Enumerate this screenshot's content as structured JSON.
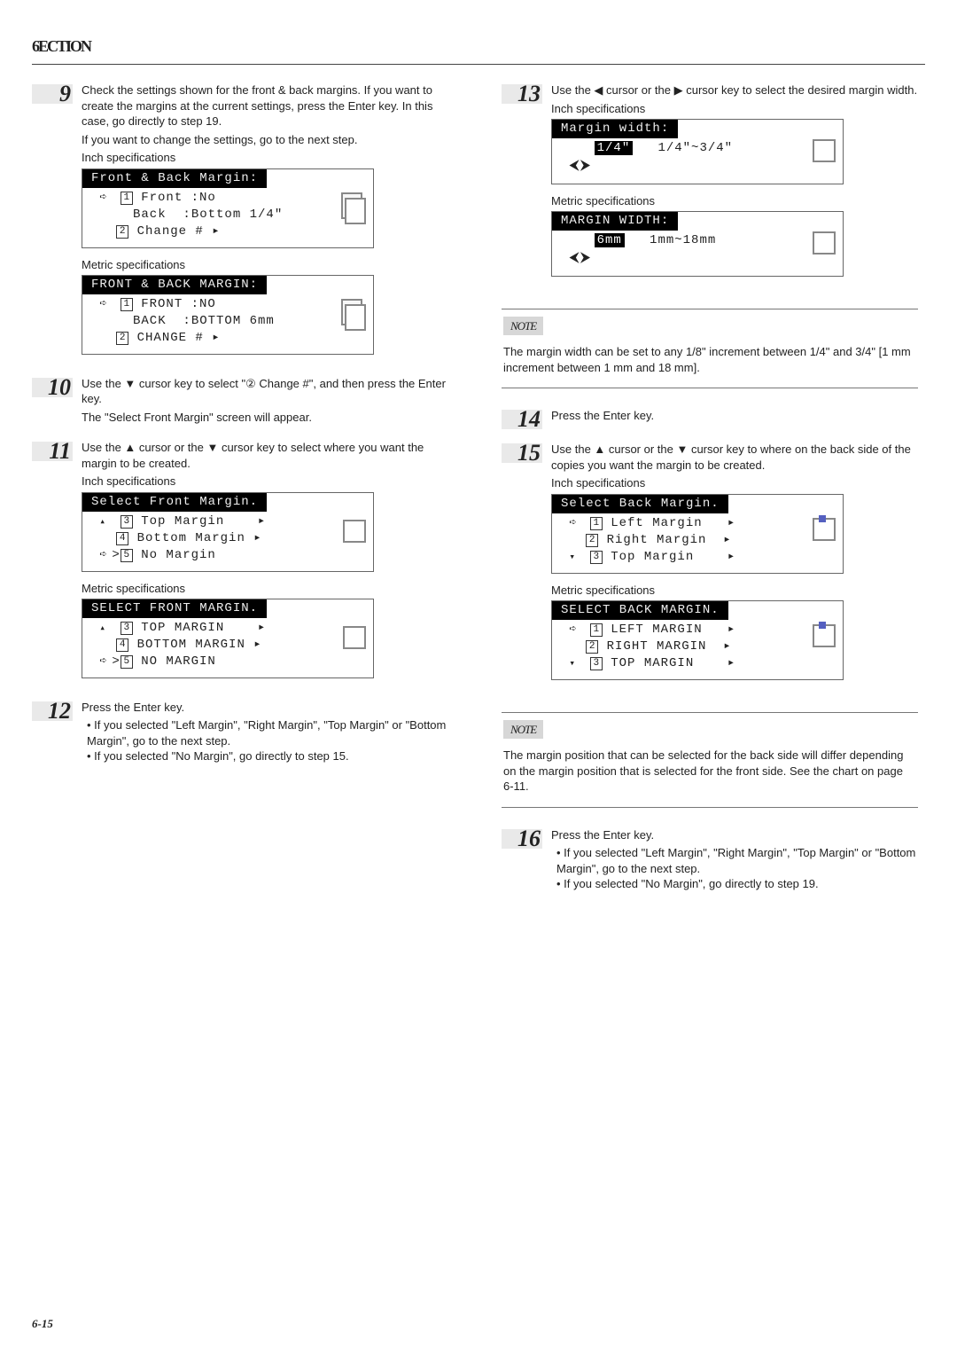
{
  "header": "6ECTION ",
  "page_footer": "6-15",
  "left": {
    "step9": {
      "num": "9",
      "p1": "Check the settings shown for the front & back margins. If you want to create the margins at the current settings, press the Enter key. In this case, go directly to step 19.",
      "p2": "If you want to change the settings, go to the next step.",
      "inch_label": "Inch specifications",
      "lcd_inch": {
        "title": "Front & Back Margin:",
        "r1a": "Front :No",
        "r2": "     Back  :Bottom 1/4\"",
        "r3a": "Change # ▸"
      },
      "metric_label": "Metric specifications",
      "lcd_metric": {
        "title": "FRONT & BACK MARGIN:",
        "r1a": "FRONT :NO",
        "r2": "     BACK  :BOTTOM 6mm",
        "r3a": "CHANGE # ▸"
      }
    },
    "step10": {
      "num": "10",
      "p1": "Use the ▼ cursor key to select \"② Change #\", and then press the Enter key.",
      "p2": "The \"Select Front Margin\" screen will appear."
    },
    "step11": {
      "num": "11",
      "p1": "Use the ▲ cursor or the ▼ cursor key to select where you want the margin to be created.",
      "inch_label": "Inch specifications",
      "lcd_inch": {
        "title": "Select Front Margin.",
        "r1": "Top Margin    ▸",
        "r2": "Bottom Margin ▸",
        "r3": "No Margin"
      },
      "metric_label": "Metric specifications",
      "lcd_metric": {
        "title": "SELECT FRONT MARGIN.",
        "r1": "TOP MARGIN    ▸",
        "r2": "BOTTOM MARGIN ▸",
        "r3": "NO MARGIN"
      }
    },
    "step12": {
      "num": "12",
      "p1": "Press the Enter key.",
      "b1": "If you selected \"Left Margin\", \"Right Margin\", \"Top Margin\" or \"Bottom Margin\", go to the next step.",
      "b2": "If you selected \"No Margin\", go directly to step 15."
    }
  },
  "right": {
    "step13": {
      "num": "13",
      "p1": "Use the ◀ cursor or the ▶ cursor key to select the desired margin width.",
      "inch_label": "Inch specifications",
      "lcd_inch": {
        "title": "Margin width:",
        "val": "1/4\"",
        "range": "1/4\"~3/4\""
      },
      "metric_label": "Metric specifications",
      "lcd_metric": {
        "title": "MARGIN WIDTH:",
        "val": "6mm",
        "range": "1mm~18mm"
      }
    },
    "note1": {
      "label": "NOTE",
      "text": "The margin width can be set to any 1/8\" increment between 1/4\" and 3/4\" [1 mm increment between 1 mm and 18 mm]."
    },
    "step14": {
      "num": "14",
      "p1": "Press the Enter key."
    },
    "step15": {
      "num": "15",
      "p1": "Use the ▲ cursor or the ▼ cursor key to where on the back side of the copies you want the margin to be created.",
      "inch_label": "Inch specifications",
      "lcd_inch": {
        "title": "Select Back Margin.",
        "r1": "Left Margin   ▸",
        "r2": "Right Margin  ▸",
        "r3": "Top Margin    ▸"
      },
      "metric_label": "Metric specifications",
      "lcd_metric": {
        "title": "SELECT BACK MARGIN.",
        "r1": "LEFT MARGIN   ▸",
        "r2": "RIGHT MARGIN  ▸",
        "r3": "TOP MARGIN    ▸"
      }
    },
    "note2": {
      "label": "NOTE",
      "text": "The margin position that can be selected for the back side will differ depending on the margin position that is selected for the front side. See the chart on page 6-11."
    },
    "step16": {
      "num": "16",
      "p1": "Press the Enter key.",
      "b1": "If you selected \"Left Margin\", \"Right Margin\", \"Top Margin\" or \"Bottom Margin\", go to the next step.",
      "b2": "If you selected \"No Margin\", go directly to step 19."
    }
  }
}
